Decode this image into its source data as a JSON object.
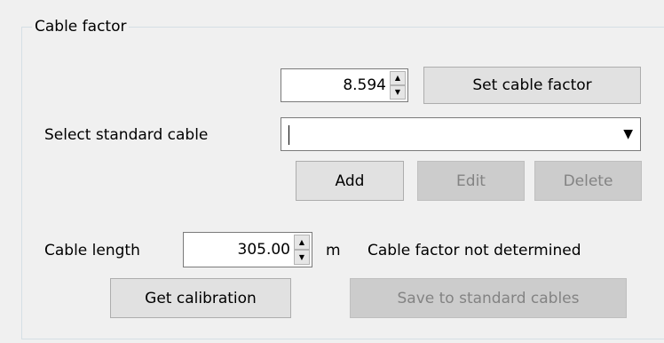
{
  "group": {
    "title": "Cable factor"
  },
  "cable_factor": {
    "value": "8.594",
    "set_button": "Set cable factor"
  },
  "standard_cable": {
    "label": "Select standard cable",
    "selected": "",
    "add": "Add",
    "edit": "Edit",
    "delete": "Delete"
  },
  "cable_length": {
    "label": "Cable length",
    "value": "305.00",
    "unit": "m",
    "status": "Cable factor not determined"
  },
  "actions": {
    "get_calibration": "Get calibration",
    "save_to_standard": "Save to standard cables"
  },
  "icons": {
    "spin_up": "up-arrow-icon",
    "spin_down": "down-arrow-icon",
    "dropdown": "dropdown-arrow-icon"
  }
}
